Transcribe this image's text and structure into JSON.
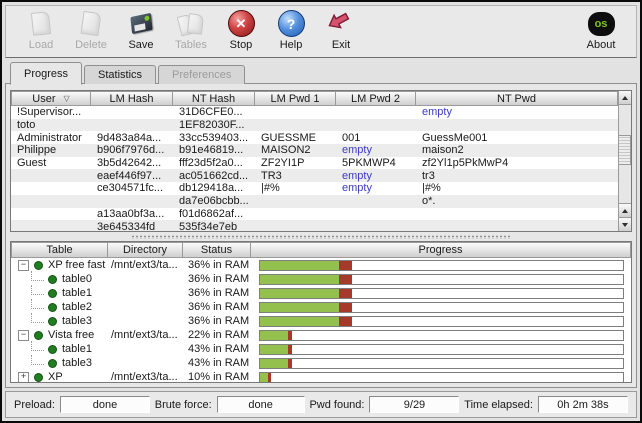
{
  "colors": {
    "progress_green": "#94c14e",
    "progress_red": "#a53a2c",
    "empty_blue": "#3c3cbe",
    "dot_green": "#1f7d1f",
    "about_green": "#7ec61e",
    "header_grad_top": "#fbfbfb",
    "header_grad_bottom": "#cfcfcf"
  },
  "toolbar": {
    "buttons": [
      {
        "label": "Load",
        "icon": "load-icon",
        "enabled": false
      },
      {
        "label": "Delete",
        "icon": "delete-icon",
        "enabled": false
      },
      {
        "label": "Save",
        "icon": "save-icon",
        "enabled": true
      },
      {
        "label": "Tables",
        "icon": "tables-icon",
        "enabled": false
      },
      {
        "label": "Stop",
        "icon": "stop-icon",
        "enabled": true
      },
      {
        "label": "Help",
        "icon": "help-icon",
        "enabled": true
      },
      {
        "label": "Exit",
        "icon": "exit-icon",
        "enabled": true
      }
    ],
    "stop_glyph": "✕",
    "help_glyph": "?",
    "about_label": "About",
    "about_logo": "os"
  },
  "tabs": [
    {
      "label": "Progress",
      "active": true,
      "enabled": true
    },
    {
      "label": "Statistics",
      "active": false,
      "enabled": true
    },
    {
      "label": "Preferences",
      "active": false,
      "enabled": false
    }
  ],
  "hash_table": {
    "columns": [
      "User",
      "LM Hash",
      "NT Hash",
      "LM Pwd 1",
      "LM Pwd 2",
      "NT Pwd"
    ],
    "sorted_column": "User",
    "sort_glyph": "▽",
    "rows": [
      {
        "cells": [
          "!Supervisor...",
          "",
          "31D6CFE0...",
          "",
          "",
          "empty"
        ]
      },
      {
        "cells": [
          "toto",
          "",
          "1EF82030F...",
          "",
          "",
          ""
        ]
      },
      {
        "cells": [
          "Administrator",
          "9d483a84a...",
          "33cc539403...",
          "GUESSME",
          "001",
          "GuessMe001"
        ]
      },
      {
        "cells": [
          "Philippe",
          "b906f7976d...",
          "b91e46819...",
          "MAISON2",
          "empty",
          "maison2"
        ]
      },
      {
        "cells": [
          "Guest",
          "3b5d42642...",
          "fff23d5f2a0...",
          "ZF2YI1P",
          "5PKMWP4",
          "zf2Yl1p5PkMwP4"
        ]
      },
      {
        "cells": [
          "",
          "eaef446f97...",
          "ac051662cd...",
          "TR3",
          "empty",
          "tr3"
        ]
      },
      {
        "cells": [
          "",
          "ce304571fc...",
          "db129418a...",
          "|#%",
          "empty",
          "|#%"
        ]
      },
      {
        "cells": [
          "",
          "",
          "da7e06bcbb...",
          "",
          "",
          "o*."
        ]
      },
      {
        "cells": [
          "",
          "a13aa0bf3a...",
          "f01d6862af...",
          "",
          "",
          ""
        ]
      },
      {
        "cells": [
          "",
          "3e645334fd",
          "535f34e7eb",
          "",
          "",
          ""
        ]
      }
    ]
  },
  "tables_table": {
    "columns": [
      "Table",
      "Directory",
      "Status",
      "Progress"
    ],
    "rows": [
      {
        "name": "XP free fast",
        "dir": "/mnt/ext3/ta...",
        "status": "36% in RAM",
        "level": 0,
        "toggle": "minus",
        "green_pct": 21.7,
        "red_pct": 3.6
      },
      {
        "name": "table0",
        "dir": "",
        "status": "36% in RAM",
        "level": 1,
        "toggle": null,
        "green_pct": 21.7,
        "red_pct": 3.6
      },
      {
        "name": "table1",
        "dir": "",
        "status": "36% in RAM",
        "level": 1,
        "toggle": null,
        "green_pct": 21.7,
        "red_pct": 3.6
      },
      {
        "name": "table2",
        "dir": "",
        "status": "36% in RAM",
        "level": 1,
        "toggle": null,
        "green_pct": 21.7,
        "red_pct": 3.6
      },
      {
        "name": "table3",
        "dir": "",
        "status": "36% in RAM",
        "level": 1,
        "toggle": null,
        "green_pct": 21.7,
        "red_pct": 3.6
      },
      {
        "name": "Vista free",
        "dir": "/mnt/ext3/ta...",
        "status": "22% in RAM",
        "level": 0,
        "toggle": "minus",
        "green_pct": 7.8,
        "red_pct": 0.9
      },
      {
        "name": "table1",
        "dir": "",
        "status": "43% in RAM",
        "level": 1,
        "toggle": null,
        "green_pct": 7.8,
        "red_pct": 0.9
      },
      {
        "name": "table3",
        "dir": "",
        "status": "43% in RAM",
        "level": 1,
        "toggle": null,
        "green_pct": 7.8,
        "red_pct": 0.9
      },
      {
        "name": "XP",
        "dir": "/mnt/ext3/ta...",
        "status": "10% in RAM",
        "level": 0,
        "toggle": "plus",
        "green_pct": 2.3,
        "red_pct": 0.7
      }
    ]
  },
  "statusbar": {
    "fields": [
      {
        "label": "Preload:",
        "value": "done"
      },
      {
        "label": "Brute force:",
        "value": "done"
      },
      {
        "label": "Pwd found:",
        "value": "9/29"
      },
      {
        "label": "Time elapsed:",
        "value": "0h 2m 38s"
      }
    ]
  }
}
